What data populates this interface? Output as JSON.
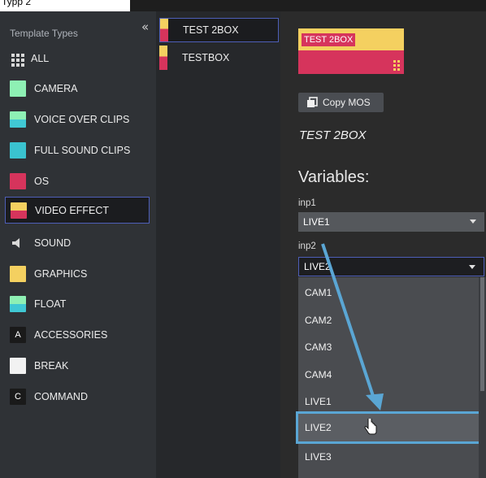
{
  "header": {
    "label": "Typp 2"
  },
  "sidebar": {
    "title": "Template Types",
    "collapse_glyph": "«",
    "items": [
      {
        "label": "ALL",
        "icon": "grid-icon"
      },
      {
        "label": "CAMERA",
        "color": "#8ef0b4"
      },
      {
        "label": "VOICE OVER CLIPS",
        "color": "#40c8d4"
      },
      {
        "label": "FULL SOUND CLIPS",
        "color": "#3ac3cf"
      },
      {
        "label": "OS",
        "color": "#d6345c"
      },
      {
        "label": "VIDEO EFFECT",
        "color": "#f4d060",
        "active": true
      },
      {
        "label": "SOUND",
        "icon": "speaker-icon"
      },
      {
        "label": "GRAPHICS",
        "color": "#f4d060"
      },
      {
        "label": "FLOAT",
        "color": "#8ef0b4"
      },
      {
        "label": "ACCESSORIES",
        "letter": "A"
      },
      {
        "label": "BREAK",
        "color": "#f2f2f2"
      },
      {
        "label": "COMMAND",
        "letter": "C"
      }
    ]
  },
  "templates": [
    {
      "label": "TEST 2BOX",
      "active": true
    },
    {
      "label": "TESTBOX",
      "active": false
    }
  ],
  "detail": {
    "preview_label": "TEST 2BOX",
    "copy_button": "Copy MOS",
    "template_name": "TEST 2BOX",
    "variables_heading": "Variables:",
    "variables": [
      {
        "name": "inp1",
        "value": "LIVE1"
      },
      {
        "name": "inp2",
        "value": "LIVE2"
      }
    ],
    "dropdown_options": [
      "CAM1",
      "CAM2",
      "CAM3",
      "CAM4",
      "LIVE1",
      "LIVE2",
      "LIVE3"
    ],
    "highlighted_option": "LIVE2"
  },
  "colors": {
    "accent_border": "#4e5fb8",
    "annotation_arrow": "#5aa6d4"
  }
}
